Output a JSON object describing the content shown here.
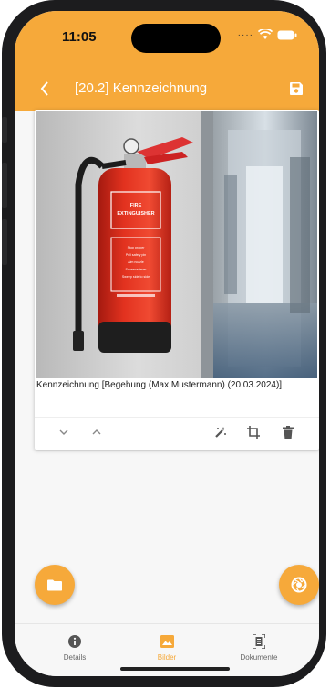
{
  "status": {
    "time": "11:05"
  },
  "appbar": {
    "title": "[20.2] Kennzeichnung"
  },
  "card": {
    "caption": "Kennzeichnung [Begehung (Max Mustermann) (20.03.2024)]",
    "sign_lines": [
      "FIRE",
      "EXTINGUISHER"
    ],
    "sign_small": [
      "Stop proper",
      "Pull safety pin",
      "Aim nozzle",
      "Squeeze lever",
      "Sweep side to side"
    ]
  },
  "nav": {
    "items": [
      {
        "label": "Details",
        "icon": "info-icon",
        "active": false
      },
      {
        "label": "Bilder",
        "icon": "image-icon",
        "active": true
      },
      {
        "label": "Dokumente",
        "icon": "document-scan-icon",
        "active": false
      }
    ]
  },
  "colors": {
    "accent": "#f6a93a",
    "extinguisher": "#e2321f"
  }
}
